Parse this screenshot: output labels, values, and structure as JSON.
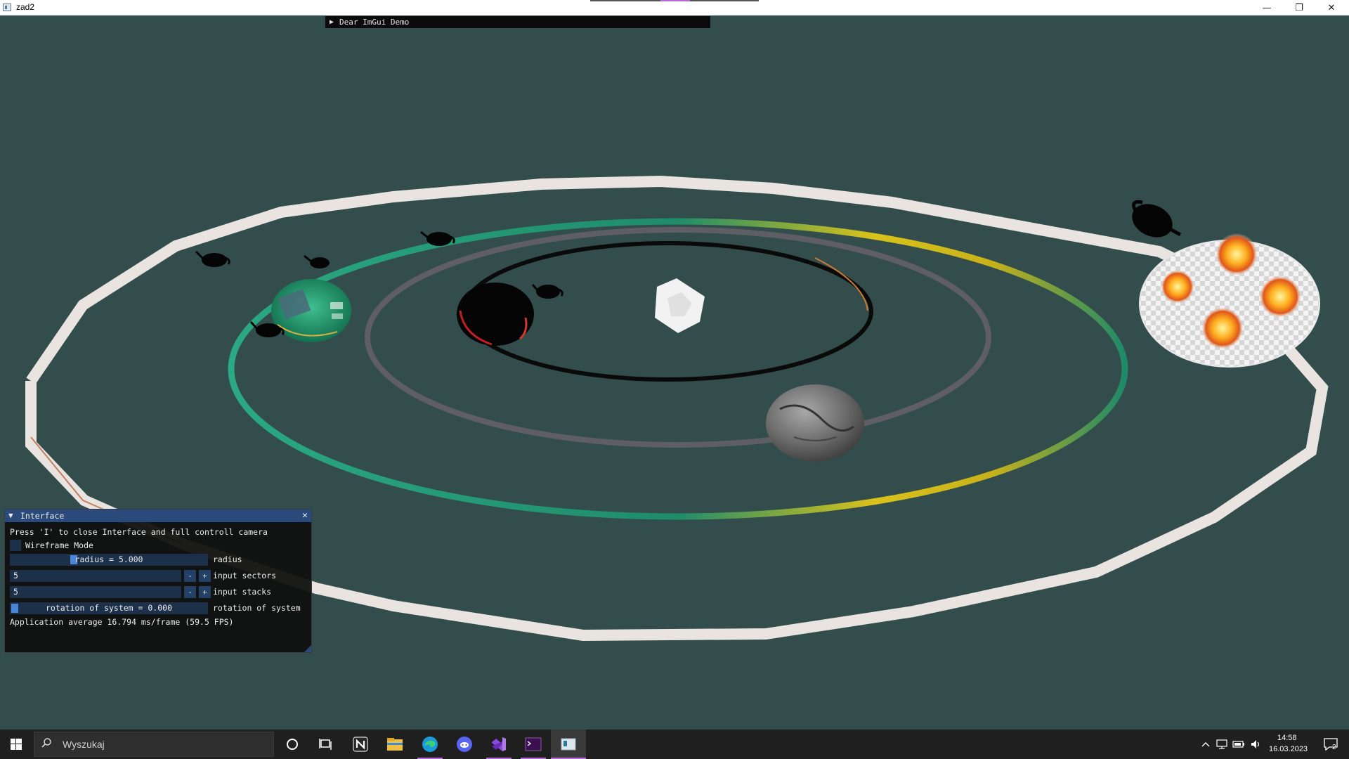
{
  "window": {
    "title": "zad2",
    "controls": {
      "minimize": "—",
      "maximize": "❐",
      "close": "✕"
    }
  },
  "demo_window": {
    "arrow": "▶",
    "title": "Dear ImGui Demo"
  },
  "interface": {
    "title": "Interface",
    "arrow": "▼",
    "close": "✕",
    "hint": "Press 'I' to close Interface and full controll camera",
    "wireframe_label": "Wireframe Mode",
    "wireframe_checked": false,
    "radius_text": "radius = 5.000",
    "radius_label": "radius",
    "sectors_value": "5",
    "sectors_label": "input sectors",
    "stacks_value": "5",
    "stacks_label": "input stacks",
    "minus": "-",
    "plus": "+",
    "rotation_text": "rotation of system = 0.000",
    "rotation_label": "rotation of system",
    "fps_text": "Application average 16.794 ms/frame (59.5 FPS)",
    "colors": {
      "header": "#294a7a",
      "frame": "#1d3049",
      "grab": "#4a85d8"
    }
  },
  "scene": {
    "background": "#334d4d",
    "objects": [
      "sun-cube",
      "dark-planet",
      "stone-planet",
      "green-planet",
      "fire-planet",
      "teapots",
      "orbits"
    ]
  },
  "taskbar": {
    "search_placeholder": "Wyszukaj",
    "apps": [
      "windows-start-icon",
      "cortana-icon",
      "task-view-icon",
      "notion-icon",
      "file-explorer-icon",
      "edge-icon",
      "discord-icon",
      "visual-studio-icon",
      "terminal-icon",
      "zad2-app-icon"
    ],
    "time": "14:58",
    "date": "16.03.2023",
    "notifications": "2",
    "tray_icons": [
      "chevron-up-icon",
      "network-icon",
      "battery-icon",
      "volume-icon"
    ]
  }
}
